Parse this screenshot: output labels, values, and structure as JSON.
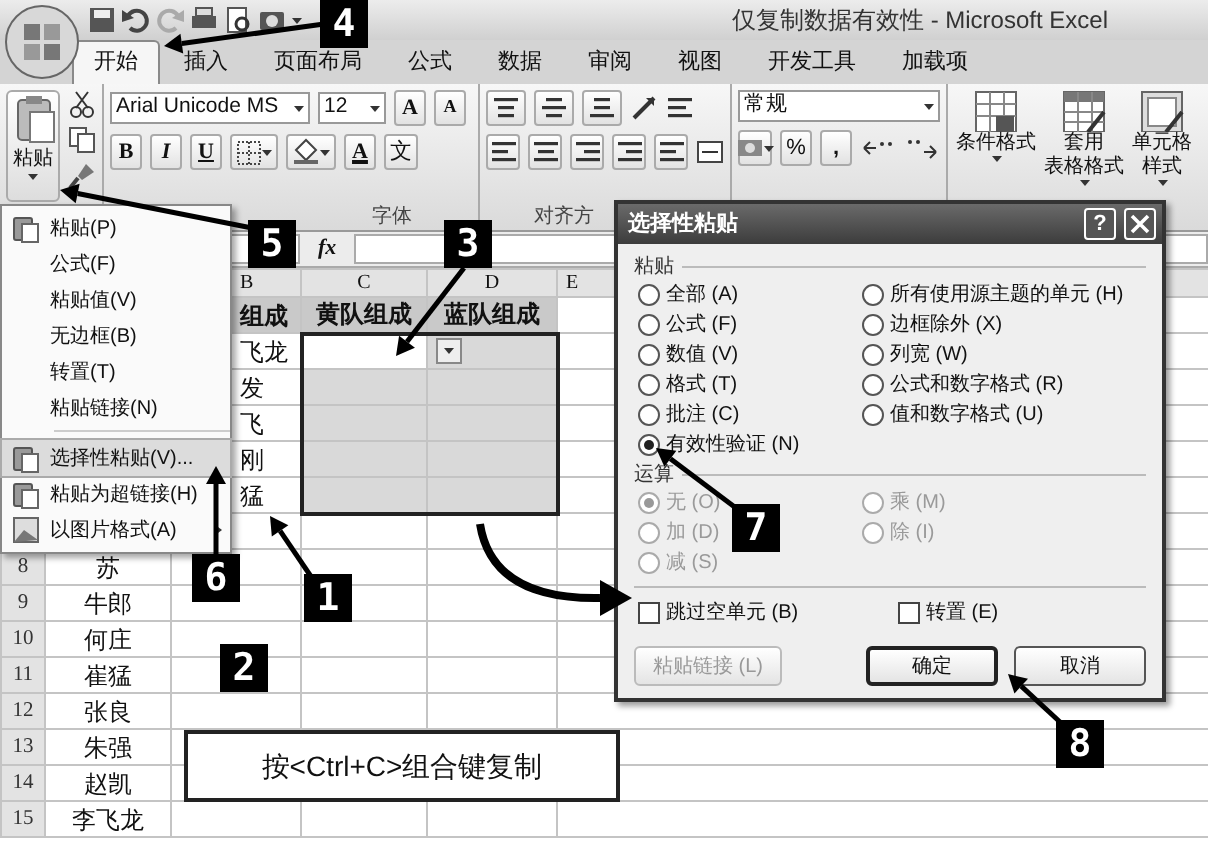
{
  "window": {
    "title": "仅复制数据有效性 - Microsoft Excel"
  },
  "tabs": [
    {
      "label": "开始",
      "selected": true
    },
    {
      "label": "插入",
      "selected": false
    },
    {
      "label": "页面布局",
      "selected": false
    },
    {
      "label": "公式",
      "selected": false
    },
    {
      "label": "数据",
      "selected": false
    },
    {
      "label": "审阅",
      "selected": false
    },
    {
      "label": "视图",
      "selected": false
    },
    {
      "label": "开发工具",
      "selected": false
    },
    {
      "label": "加载项",
      "selected": false
    }
  ],
  "ribbon": {
    "paste": {
      "label": "粘贴"
    },
    "font": {
      "font_name": "Arial Unicode MS",
      "font_size": "12",
      "grow": "A",
      "shrink": "A",
      "bold": "B",
      "italic": "I",
      "underline": "U",
      "font_color": "A",
      "phonetic": "文",
      "group_label": "字体"
    },
    "alignment": {
      "group_label": "对齐方"
    },
    "number": {
      "format": "常规",
      "percent": "%",
      "comma": ","
    },
    "styles": [
      {
        "lines": [
          "条件格式"
        ]
      },
      {
        "lines": [
          "套用",
          "表格格式"
        ]
      },
      {
        "lines": [
          "单元格",
          "样式"
        ]
      }
    ]
  },
  "formula_bar": {
    "fx": "fx"
  },
  "sheet": {
    "columns": [
      "B",
      "C",
      "D",
      "E"
    ],
    "rows": [
      {
        "kind": "header",
        "b": "组成",
        "c": "黄队组成",
        "d": "蓝队组成",
        "copied": false,
        "selected": false
      },
      {
        "kind": "data",
        "b": "飞龙",
        "copied": true,
        "selected": true
      },
      {
        "kind": "data",
        "b": "发",
        "copied": true,
        "selected": true
      },
      {
        "kind": "data",
        "b": "飞",
        "copied": true,
        "selected": true
      },
      {
        "kind": "data",
        "b": "刚",
        "copied": true,
        "selected": true
      },
      {
        "kind": "data",
        "b": "猛",
        "copied": true,
        "selected": true
      },
      {
        "kind": "data",
        "copied": false,
        "selected": false
      },
      {
        "kind": "data",
        "number": "8",
        "a": "苏",
        "copied": false,
        "selected": false
      },
      {
        "kind": "data",
        "number": "9",
        "a": "牛郎",
        "copied": false,
        "selected": false
      },
      {
        "kind": "data",
        "number": "10",
        "a": "何庄",
        "copied": false,
        "selected": false
      },
      {
        "kind": "data",
        "number": "11",
        "a": "崔猛",
        "copied": false,
        "selected": false
      },
      {
        "kind": "data",
        "number": "12",
        "a": "张良",
        "copied": false,
        "selected": false
      },
      {
        "kind": "data",
        "number": "13",
        "a": "朱强",
        "copied": false,
        "selected": false
      },
      {
        "kind": "data",
        "number": "14",
        "a": "赵凯",
        "copied": false,
        "selected": false
      },
      {
        "kind": "data",
        "number": "15",
        "a": "李飞龙",
        "copied": false,
        "selected": false
      }
    ]
  },
  "paste_menu": {
    "items": [
      {
        "kind": "paste",
        "label": "粘贴(P)",
        "selected": false
      },
      {
        "kind": "plain",
        "label": "公式(F)",
        "selected": false
      },
      {
        "kind": "plain",
        "label": "粘贴值(V)",
        "selected": false
      },
      {
        "kind": "plain",
        "label": "无边框(B)",
        "selected": false
      },
      {
        "kind": "plain",
        "label": "转置(T)",
        "selected": false
      },
      {
        "kind": "plain",
        "label": "粘贴链接(N)",
        "selected": false
      },
      {
        "kind": "separator"
      },
      {
        "kind": "paste",
        "label": "选择性粘贴(V)...",
        "selected": true
      },
      {
        "kind": "paste",
        "label": "粘贴为超链接(H)",
        "selected": false
      },
      {
        "kind": "picture",
        "label": "以图片格式(A)",
        "selected": false,
        "submenu": true
      }
    ]
  },
  "dialog": {
    "title": "选择性粘贴",
    "help": "?",
    "paste_label": "粘贴",
    "paste_options": [
      {
        "label": "全部 (A)",
        "selected": false
      },
      {
        "label": "所有使用源主题的单元 (H)",
        "selected": false
      },
      {
        "label": "公式 (F)",
        "selected": false
      },
      {
        "label": "边框除外 (X)",
        "selected": false
      },
      {
        "label": "数值 (V)",
        "selected": false
      },
      {
        "label": "列宽 (W)",
        "selected": false
      },
      {
        "label": "格式 (T)",
        "selected": false
      },
      {
        "label": "公式和数字格式 (R)",
        "selected": false
      },
      {
        "label": "批注 (C)",
        "selected": false
      },
      {
        "label": "值和数字格式 (U)",
        "selected": false
      },
      {
        "label": "有效性验证 (N)",
        "selected": true
      }
    ],
    "operation_label": "运算",
    "operation_options": [
      {
        "label": "无 (O)",
        "selected": true,
        "disabled": true
      },
      {
        "label": "乘 (M)",
        "selected": false,
        "disabled": true
      },
      {
        "label": "加 (D)",
        "selected": false,
        "disabled": true
      },
      {
        "label": "除 (I)",
        "selected": false,
        "disabled": true
      },
      {
        "label": "减 (S)",
        "selected": false,
        "disabled": true
      }
    ],
    "checkboxes": [
      {
        "label": "跳过空单元 (B)",
        "checked": false
      },
      {
        "label": "转置 (E)",
        "checked": false
      }
    ],
    "buttons": [
      {
        "label": "粘贴链接 (L)",
        "disabled": true,
        "default": false
      },
      {
        "label": "确定",
        "disabled": false,
        "default": true
      },
      {
        "label": "取消",
        "disabled": false,
        "default": false
      }
    ]
  },
  "note": {
    "text": "按<Ctrl+C>组合键复制"
  },
  "callouts": [
    {
      "number": "1"
    },
    {
      "number": "2"
    },
    {
      "number": "3"
    },
    {
      "number": "4"
    },
    {
      "number": "5"
    },
    {
      "number": "6"
    },
    {
      "number": "7"
    },
    {
      "number": "8"
    }
  ]
}
